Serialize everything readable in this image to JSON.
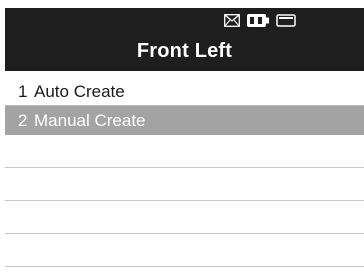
{
  "header": {
    "title": "Front Left",
    "icons": [
      "mail-icon",
      "battery-charging-icon",
      "battery-icon"
    ]
  },
  "menu": {
    "items": [
      {
        "number": "1",
        "label": "Auto Create",
        "selected": false
      },
      {
        "number": "2",
        "label": "Manual Create",
        "selected": true
      }
    ]
  },
  "colors": {
    "header_bg": "#1e1e1e",
    "header_text": "#ffffff",
    "selected_bg": "#a3a3a3",
    "divider": "#b8b8b8"
  }
}
